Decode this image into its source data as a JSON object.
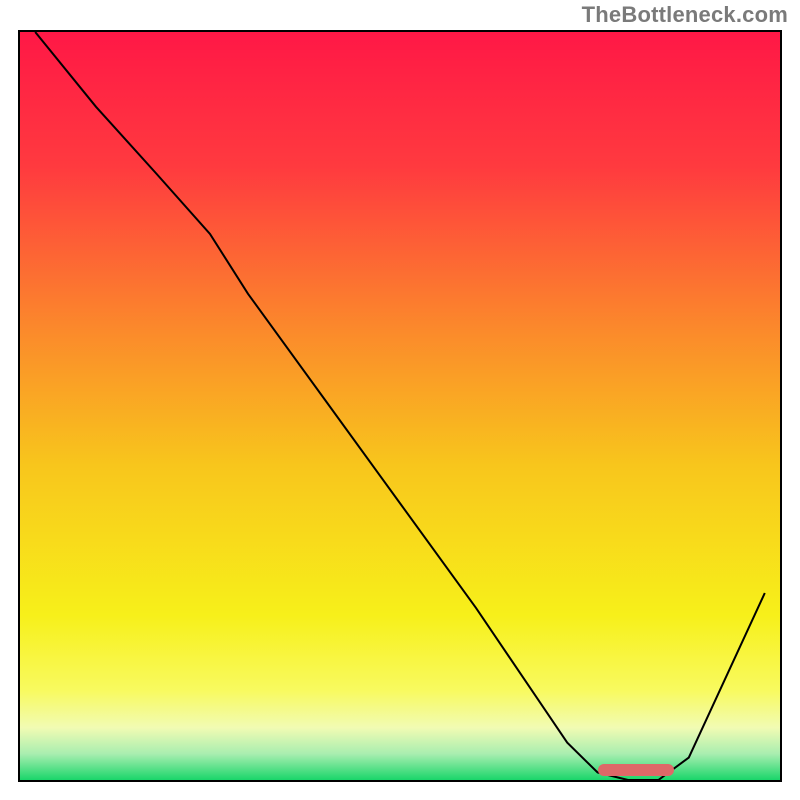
{
  "watermark": "TheBottleneck.com",
  "chart_data": {
    "type": "line",
    "title": "",
    "xlabel": "",
    "ylabel": "",
    "xlim": [
      0,
      100
    ],
    "ylim": [
      0,
      100
    ],
    "grid": false,
    "legend": false,
    "background_gradient": {
      "stops": [
        {
          "pos": 0.0,
          "color": "#ff1846"
        },
        {
          "pos": 0.18,
          "color": "#ff3a3f"
        },
        {
          "pos": 0.4,
          "color": "#fb8a2b"
        },
        {
          "pos": 0.58,
          "color": "#f8c61c"
        },
        {
          "pos": 0.78,
          "color": "#f7f01a"
        },
        {
          "pos": 0.88,
          "color": "#f8fa5f"
        },
        {
          "pos": 0.93,
          "color": "#f1fbb3"
        },
        {
          "pos": 0.965,
          "color": "#a9eeb0"
        },
        {
          "pos": 1.0,
          "color": "#1ad66a"
        }
      ]
    },
    "series": [
      {
        "name": "bottleneck-curve",
        "color": "#000000",
        "stroke_width": 2,
        "x": [
          2,
          10,
          18,
          25,
          30,
          40,
          50,
          60,
          68,
          72,
          76,
          80,
          84,
          88,
          98
        ],
        "values": [
          100,
          90,
          81,
          73,
          65,
          51,
          37,
          23,
          11,
          5,
          1,
          0,
          0,
          3,
          25
        ]
      }
    ],
    "marker": {
      "name": "optimal-range",
      "color": "#de6868",
      "x_start": 76,
      "x_end": 86,
      "y": 0.5
    }
  }
}
